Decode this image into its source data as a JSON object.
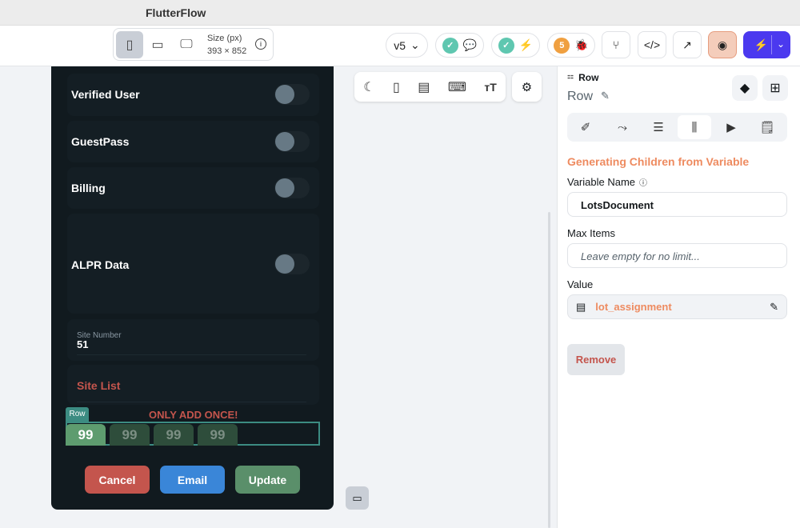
{
  "app": {
    "title": "FlutterFlow"
  },
  "toolbar": {
    "size_label": "Size (px)",
    "size_value": "393 × 852",
    "version": "v5",
    "bug_count": "5"
  },
  "phone": {
    "toggles": [
      {
        "label": "Verified User"
      },
      {
        "label": "GuestPass"
      },
      {
        "label": "Billing"
      },
      {
        "label": "ALPR Data"
      }
    ],
    "site_number": {
      "label": "Site Number",
      "value": "51"
    },
    "site_list": "Site List",
    "row_tag": "Row",
    "warning": "ONLY ADD ONCE!",
    "chips": [
      "99",
      "99",
      "99",
      "99"
    ],
    "buttons": {
      "cancel": "Cancel",
      "email": "Email",
      "update": "Update"
    }
  },
  "panel": {
    "widget_type": "Row",
    "widget_name": "Row",
    "section_title": "Generating Children from Variable",
    "variable_name_label": "Variable Name",
    "variable_name_value": "LotsDocument",
    "max_items_label": "Max Items",
    "max_items_placeholder": "Leave empty for no limit...",
    "value_label": "Value",
    "value_value": "lot_assignment",
    "remove_label": "Remove"
  },
  "colors": {
    "accent": "#ee8b60",
    "primary": "#4b39ef",
    "green": "#5a8f6a",
    "red": "#c4554d",
    "blue": "#3a86d8"
  }
}
